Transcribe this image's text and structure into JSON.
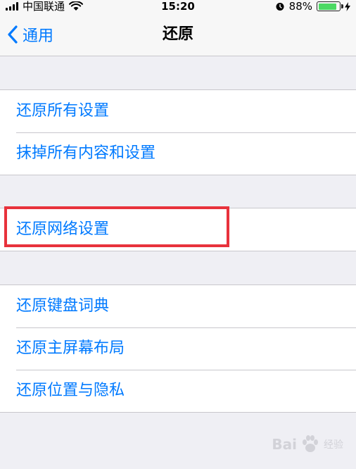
{
  "status_bar": {
    "carrier": "中国联通",
    "time": "15:20",
    "battery_percent": "88%",
    "battery_level": 0.88,
    "icons": [
      "signal-icon",
      "wifi-icon",
      "alarm-icon",
      "battery-icon",
      "charging-icon"
    ]
  },
  "nav": {
    "back_label": "通用",
    "title": "还原"
  },
  "groups": [
    {
      "items": [
        {
          "label": "还原所有设置"
        },
        {
          "label": "抹掉所有内容和设置"
        }
      ]
    },
    {
      "items": [
        {
          "label": "还原网络设置"
        }
      ]
    },
    {
      "items": [
        {
          "label": "还原键盘词典"
        },
        {
          "label": "还原主屏幕布局"
        },
        {
          "label": "还原位置与隐私"
        }
      ]
    }
  ],
  "watermark": {
    "text": "Bai",
    "sub": "经验"
  },
  "colors": {
    "accent": "#007aff",
    "highlight": "#e8323c",
    "background": "#efeff4",
    "battery": "#4cd964"
  }
}
